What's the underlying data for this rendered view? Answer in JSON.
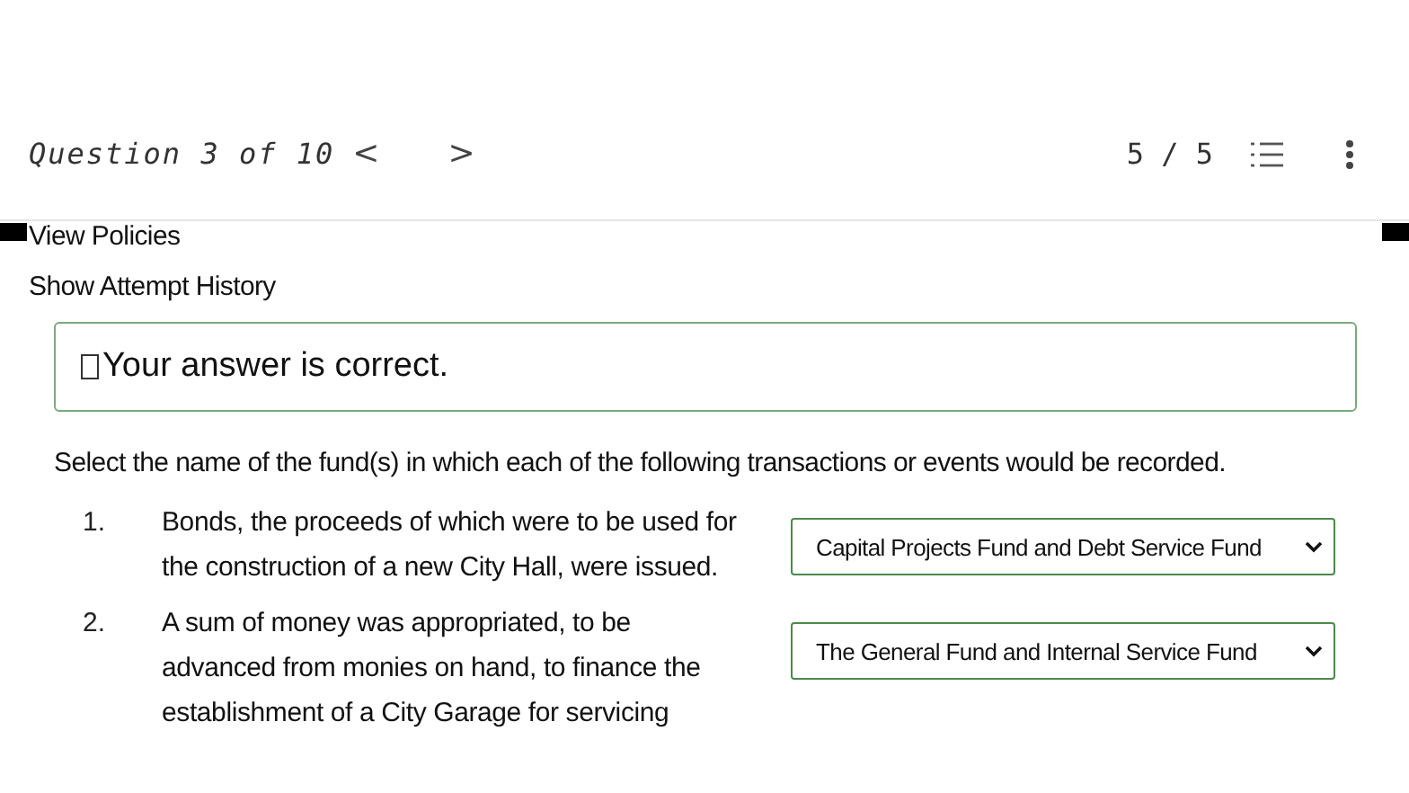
{
  "header": {
    "question_label": "Question 3 of 10",
    "prev": "<",
    "next": ">",
    "score": "5 / 5"
  },
  "links": [
    "View Policies",
    "Show Attempt History"
  ],
  "feedback": {
    "text": "Your answer is correct."
  },
  "instruction": "Select the name of the fund(s) in which each of the following transactions or events would be recorded.",
  "items": [
    {
      "number": "1.",
      "text": "Bonds, the proceeds of which were to be used for the construction of a new City Hall, were issued.",
      "answer": "Capital Projects Fund and Debt Service Fund"
    },
    {
      "number": "2.",
      "text": "A sum of money was appropriated, to be advanced from monies on hand, to finance the establishment of a City Garage for servicing",
      "answer": "The General Fund and Internal Service Fund"
    }
  ]
}
